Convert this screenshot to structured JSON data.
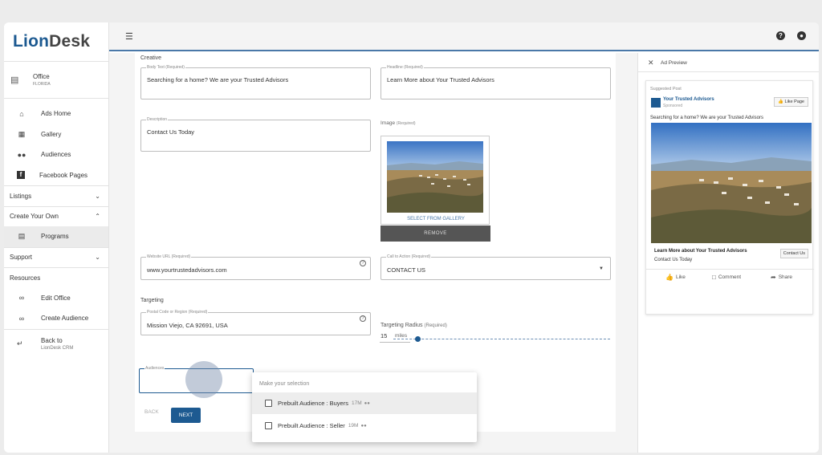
{
  "app": {
    "logo_part1": "Li",
    "logo_o": "o",
    "logo_part2": "n",
    "logo_part3": "Desk"
  },
  "sidebar": {
    "office": {
      "name": "Office",
      "region": "FLORIDA"
    },
    "items": [
      {
        "label": "Ads Home",
        "icon": "home-icon"
      },
      {
        "label": "Gallery",
        "icon": "gallery-icon"
      },
      {
        "label": "Audiences",
        "icon": "people-icon"
      },
      {
        "label": "Facebook Pages",
        "icon": "facebook-icon"
      }
    ],
    "listings": "Listings",
    "create_your_own": "Create Your Own",
    "programs": "Programs",
    "support": "Support",
    "resources": "Resources",
    "edit_office": "Edit Office",
    "create_audience": "Create Audience",
    "back_line1": "Back to",
    "back_line2": "LionDesk CRM"
  },
  "form": {
    "creative_label": "Creative",
    "body_text": {
      "label": "Body Text (Required)",
      "value": "Searching for a home? We are your Trusted Advisors"
    },
    "headline": {
      "label": "Headline (Required)",
      "value": "Learn More about Your Trusted Advisors"
    },
    "description": {
      "label": "Description",
      "value": "Contact Us Today"
    },
    "image_label": "Image",
    "image_required": "(Required)",
    "select_gallery": "SELECT FROM GALLERY",
    "remove": "REMOVE",
    "website_url": {
      "label": "Website URL (Required)",
      "value": "www.yourtrustedadvisors.com"
    },
    "cta": {
      "label": "Call to Action (Required)",
      "value": "CONTACT US"
    },
    "targeting_label": "Targeting",
    "postal": {
      "label": "Postal Code or Region (Required)",
      "value": "Mission Viejo, CA 92691, USA"
    },
    "radius_label": "Targeting Radius",
    "radius_required": "(Required)",
    "radius_value": "15",
    "radius_unit": "miles",
    "audiences_label": "Audiences",
    "back": "BACK",
    "next": "NEXT"
  },
  "dropdown": {
    "header": "Make your selection",
    "options": [
      {
        "label": "Prebuilt Audience : Buyers",
        "count": "17M"
      },
      {
        "label": "Prebuilt Audience : Seller",
        "count": "19M"
      }
    ]
  },
  "preview": {
    "title": "Ad Preview",
    "suggested": "Suggested Post",
    "page_name": "Your Trusted Advisors",
    "sponsored": "Sponsored",
    "like_page": "Like Page",
    "body": "Searching for a home? We are your Trusted Advisors",
    "headline": "Learn More about Your Trusted Advisors",
    "description": "Contact Us Today",
    "cta": "Contact Us",
    "like": "Like",
    "comment": "Comment",
    "share": "Share"
  },
  "colors": {
    "brand": "#1d5a91",
    "accent_border": "#4a78a8"
  }
}
